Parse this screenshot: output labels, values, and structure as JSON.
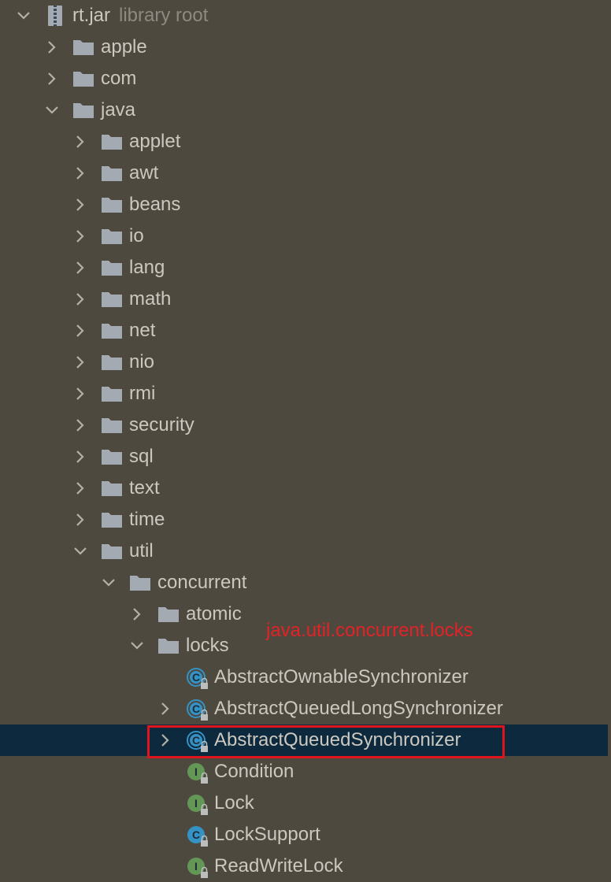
{
  "tree": {
    "root": {
      "label": "rt.jar",
      "sublabel": "library root"
    },
    "items": [
      {
        "label": "apple",
        "depth": 1,
        "kind": "folder",
        "expanded": false
      },
      {
        "label": "com",
        "depth": 1,
        "kind": "folder",
        "expanded": false
      },
      {
        "label": "java",
        "depth": 1,
        "kind": "folder",
        "expanded": true
      },
      {
        "label": "applet",
        "depth": 2,
        "kind": "folder",
        "expanded": false
      },
      {
        "label": "awt",
        "depth": 2,
        "kind": "folder",
        "expanded": false
      },
      {
        "label": "beans",
        "depth": 2,
        "kind": "folder",
        "expanded": false
      },
      {
        "label": "io",
        "depth": 2,
        "kind": "folder",
        "expanded": false
      },
      {
        "label": "lang",
        "depth": 2,
        "kind": "folder",
        "expanded": false
      },
      {
        "label": "math",
        "depth": 2,
        "kind": "folder",
        "expanded": false
      },
      {
        "label": "net",
        "depth": 2,
        "kind": "folder",
        "expanded": false
      },
      {
        "label": "nio",
        "depth": 2,
        "kind": "folder",
        "expanded": false
      },
      {
        "label": "rmi",
        "depth": 2,
        "kind": "folder",
        "expanded": false
      },
      {
        "label": "security",
        "depth": 2,
        "kind": "folder",
        "expanded": false
      },
      {
        "label": "sql",
        "depth": 2,
        "kind": "folder",
        "expanded": false
      },
      {
        "label": "text",
        "depth": 2,
        "kind": "folder",
        "expanded": false
      },
      {
        "label": "time",
        "depth": 2,
        "kind": "folder",
        "expanded": false
      },
      {
        "label": "util",
        "depth": 2,
        "kind": "folder",
        "expanded": true
      },
      {
        "label": "concurrent",
        "depth": 3,
        "kind": "folder",
        "expanded": true
      },
      {
        "label": "atomic",
        "depth": 4,
        "kind": "folder",
        "expanded": false
      },
      {
        "label": "locks",
        "depth": 4,
        "kind": "folder",
        "expanded": true
      },
      {
        "label": "AbstractOwnableSynchronizer",
        "depth": 5,
        "kind": "abstract-class",
        "expandable": false
      },
      {
        "label": "AbstractQueuedLongSynchronizer",
        "depth": 5,
        "kind": "abstract-class",
        "expandable": true
      },
      {
        "label": "AbstractQueuedSynchronizer",
        "depth": 5,
        "kind": "abstract-class",
        "expandable": true,
        "selected": true
      },
      {
        "label": "Condition",
        "depth": 5,
        "kind": "interface",
        "expandable": false
      },
      {
        "label": "Lock",
        "depth": 5,
        "kind": "interface",
        "expandable": false
      },
      {
        "label": "LockSupport",
        "depth": 5,
        "kind": "class",
        "expandable": false
      },
      {
        "label": "ReadWriteLock",
        "depth": 5,
        "kind": "interface",
        "expandable": false
      }
    ]
  },
  "annotation": {
    "text": "java.util.concurrent.locks"
  },
  "icons": {
    "chevron_right": "chevron-right-icon",
    "chevron_down": "chevron-down-icon",
    "folder": "folder-icon",
    "jar": "jar-archive-icon",
    "abstract_class": "abstract-class-icon",
    "class": "class-icon",
    "interface": "interface-icon",
    "lock_badge": "lock-badge-icon"
  },
  "colors": {
    "background": "#4d493f",
    "selection": "#0d293e",
    "text": "#ccc8c0",
    "muted_text": "#8d8a82",
    "folder": "#a3aab2",
    "class_icon": "#3592c4",
    "interface_icon": "#629755",
    "annotation": "#e32228",
    "highlight_border": "#e0141c"
  }
}
